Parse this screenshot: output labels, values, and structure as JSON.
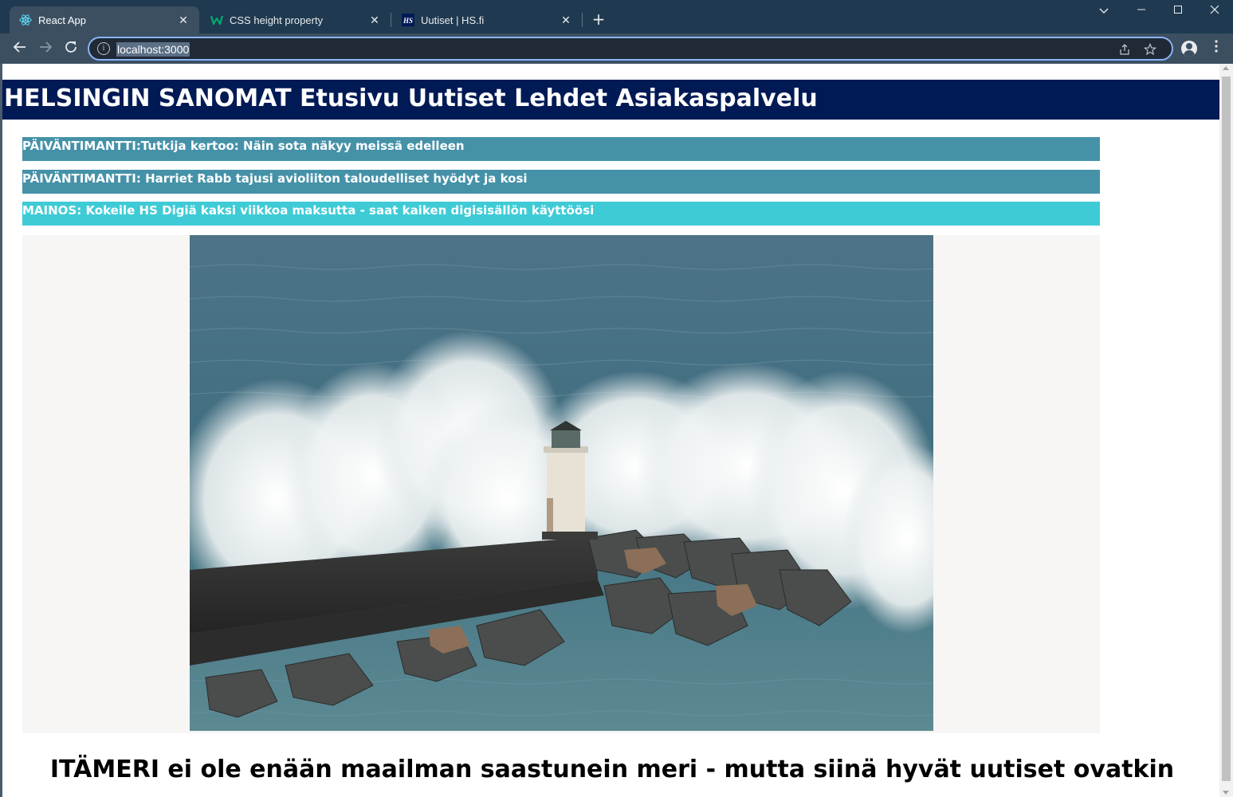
{
  "browser": {
    "tabs": [
      {
        "title": "React App",
        "active": true,
        "favicon": "react-icon"
      },
      {
        "title": "CSS height property",
        "active": false,
        "favicon": "w3-icon"
      },
      {
        "title": "Uutiset | HS.fi",
        "active": false,
        "favicon": "hs-icon"
      }
    ],
    "url": "localhost:3000"
  },
  "site": {
    "header": {
      "brand": "HELSINGIN SANOMAT",
      "nav": [
        "Etusivu",
        "Uutiset",
        "Lehdet",
        "Asiakaspalvelu"
      ]
    },
    "news_bars": [
      {
        "text": "PÄIVÄNTIMANTTI:Tutkija kertoo: Näin sota näkyy meissä edelleen",
        "color": "#4592a8"
      },
      {
        "text": "PÄIVÄNTIMANTTI: Harriet Rabb tajusi avioliiton taloudelliset hyödyt ja kosi",
        "color": "#4592a8"
      },
      {
        "text": "MAINOS: Kokeile HS Digiä kaksi viikkoa maksutta - saat kaiken digisisällön käyttöösi",
        "color": "#3fcbd6"
      }
    ],
    "headline": "ITÄMERI ei ole enään maailman saastunein meri - mutta siinä hyvät uutiset ovatkin",
    "colors": {
      "header_bg": "#001a55",
      "bar_teal": "#4592a8",
      "bar_cyan": "#3fcbd6"
    }
  }
}
